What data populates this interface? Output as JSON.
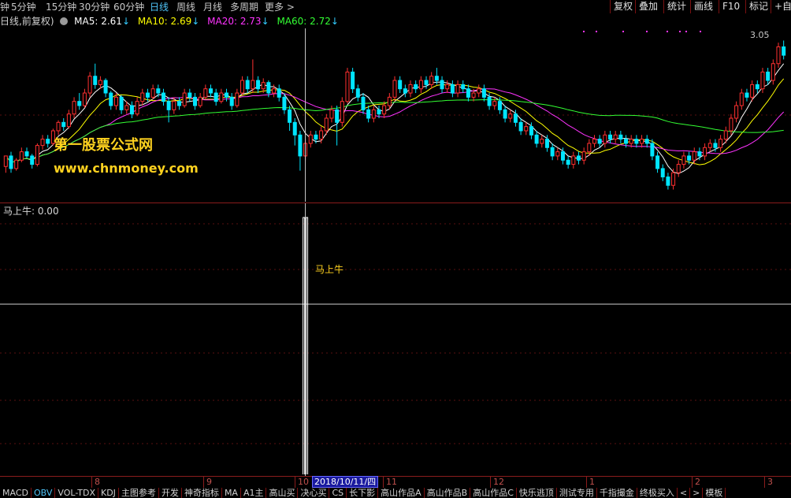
{
  "periods": [
    "钟",
    "5分钟",
    "15分钟",
    "30分钟",
    "60分钟",
    "日线",
    "周线",
    "月线",
    "多周期",
    "更多"
  ],
  "period_more_arrow": ">",
  "active_period": 5,
  "toolbar_right": [
    "复权",
    "叠加",
    "统计",
    "画线",
    "F10",
    "标记",
    "+自"
  ],
  "info": {
    "prefix": "日线,前复权)",
    "ma5": "MA5: 2.61",
    "ma10": "MA10: 2.69",
    "ma20": "MA20: 2.73",
    "ma60": "MA60: 2.72",
    "down_arrow": "↓",
    "colors": {
      "ma5": "#ffffff",
      "ma10": "#ffff00",
      "ma20": "#ff33ff",
      "ma60": "#33ff33"
    }
  },
  "price_label": "3.05",
  "watermark": {
    "line1": "第一股票公式网",
    "line2": "www.chnmoney.com"
  },
  "indicator": {
    "title": "马上牛: 0.00",
    "signal_label": "马上牛"
  },
  "date_axis": {
    "ticks": [
      "8",
      "9",
      "10",
      "11",
      "12",
      "1",
      "2",
      "3"
    ],
    "cursor_date": "2018/10/11/四"
  },
  "bottom_tabs": [
    "MACD",
    "OBV",
    "VOL-TDX",
    "KDJ",
    "主图参考",
    "开发",
    "神奇指标",
    "MA",
    "A1主",
    "高山买",
    "决心买",
    "CS",
    "长下影",
    "高山作品A",
    "高山作品B",
    "高山作品C",
    "快乐逃顶",
    "测试专用",
    "千指撮金",
    "终极买入",
    "<",
    ">",
    "模板"
  ],
  "active_tab": 1,
  "chart_data": {
    "type": "candlestick",
    "series": [
      {
        "name": "MA5",
        "color": "#ffffff"
      },
      {
        "name": "MA10",
        "color": "#ffff00"
      },
      {
        "name": "MA20",
        "color": "#ff33ff"
      },
      {
        "name": "MA60",
        "color": "#33ff33"
      }
    ],
    "colors": {
      "up": "#ff3030",
      "down": "#00e5ff"
    },
    "candles": [
      [
        2.45,
        2.5,
        2.5,
        2.42
      ],
      [
        2.5,
        2.44,
        2.52,
        2.42
      ],
      [
        2.44,
        2.48,
        2.49,
        2.43
      ],
      [
        2.48,
        2.52,
        2.54,
        2.47
      ],
      [
        2.52,
        2.5,
        2.54,
        2.49
      ],
      [
        2.5,
        2.46,
        2.51,
        2.44
      ],
      [
        2.46,
        2.55,
        2.56,
        2.45
      ],
      [
        2.55,
        2.58,
        2.6,
        2.53
      ],
      [
        2.58,
        2.56,
        2.6,
        2.54
      ],
      [
        2.56,
        2.62,
        2.63,
        2.55
      ],
      [
        2.62,
        2.66,
        2.67,
        2.6
      ],
      [
        2.66,
        2.64,
        2.68,
        2.62
      ],
      [
        2.64,
        2.7,
        2.72,
        2.63
      ],
      [
        2.7,
        2.76,
        2.78,
        2.68
      ],
      [
        2.76,
        2.74,
        2.8,
        2.72
      ],
      [
        2.74,
        2.8,
        2.82,
        2.73
      ],
      [
        2.8,
        2.88,
        2.9,
        2.78
      ],
      [
        2.88,
        2.84,
        2.94,
        2.82
      ],
      [
        2.84,
        2.86,
        2.88,
        2.82
      ],
      [
        2.86,
        2.8,
        2.87,
        2.78
      ],
      [
        2.8,
        2.74,
        2.81,
        2.72
      ],
      [
        2.74,
        2.78,
        2.8,
        2.72
      ],
      [
        2.78,
        2.72,
        2.79,
        2.7
      ],
      [
        2.72,
        2.74,
        2.76,
        2.7
      ],
      [
        2.74,
        2.7,
        2.76,
        2.68
      ],
      [
        2.7,
        2.76,
        2.78,
        2.69
      ],
      [
        2.76,
        2.8,
        2.82,
        2.74
      ],
      [
        2.8,
        2.78,
        2.82,
        2.76
      ],
      [
        2.78,
        2.82,
        2.84,
        2.77
      ],
      [
        2.82,
        2.8,
        2.84,
        2.78
      ],
      [
        2.8,
        2.76,
        2.82,
        2.74
      ],
      [
        2.76,
        2.72,
        2.78,
        2.66
      ],
      [
        2.72,
        2.76,
        2.78,
        2.7
      ],
      [
        2.76,
        2.74,
        2.78,
        2.72
      ],
      [
        2.74,
        2.8,
        2.82,
        2.73
      ],
      [
        2.8,
        2.78,
        2.82,
        2.76
      ],
      [
        2.78,
        2.74,
        2.8,
        2.72
      ],
      [
        2.74,
        2.78,
        2.8,
        2.73
      ],
      [
        2.78,
        2.82,
        2.84,
        2.77
      ],
      [
        2.82,
        2.8,
        2.84,
        2.78
      ],
      [
        2.8,
        2.76,
        2.82,
        2.74
      ],
      [
        2.76,
        2.8,
        2.82,
        2.75
      ],
      [
        2.8,
        2.78,
        2.82,
        2.76
      ],
      [
        2.78,
        2.74,
        2.8,
        2.72
      ],
      [
        2.74,
        2.8,
        2.82,
        2.73
      ],
      [
        2.8,
        2.86,
        2.88,
        2.79
      ],
      [
        2.86,
        2.82,
        2.88,
        2.8
      ],
      [
        2.82,
        2.86,
        2.96,
        2.8
      ],
      [
        2.86,
        2.82,
        2.88,
        2.8
      ],
      [
        2.82,
        2.85,
        2.87,
        2.8
      ],
      [
        2.85,
        2.8,
        2.86,
        2.78
      ],
      [
        2.8,
        2.82,
        2.84,
        2.78
      ],
      [
        2.82,
        2.78,
        2.84,
        2.76
      ],
      [
        2.78,
        2.72,
        2.8,
        2.7
      ],
      [
        2.72,
        2.66,
        2.74,
        2.62
      ],
      [
        2.66,
        2.6,
        2.68,
        2.55
      ],
      [
        2.6,
        2.5,
        2.62,
        2.43
      ],
      [
        2.5,
        2.56,
        2.58,
        2.48
      ],
      [
        2.56,
        2.6,
        2.62,
        2.54
      ],
      [
        2.6,
        2.58,
        2.62,
        2.56
      ],
      [
        2.58,
        2.62,
        2.64,
        2.56
      ],
      [
        2.62,
        2.68,
        2.7,
        2.6
      ],
      [
        2.68,
        2.72,
        2.74,
        2.66
      ],
      [
        2.72,
        2.66,
        2.74,
        2.55
      ],
      [
        2.66,
        2.76,
        2.78,
        2.64
      ],
      [
        2.76,
        2.9,
        2.92,
        2.75
      ],
      [
        2.9,
        2.82,
        2.92,
        2.8
      ],
      [
        2.82,
        2.78,
        2.84,
        2.76
      ],
      [
        2.78,
        2.72,
        2.8,
        2.7
      ],
      [
        2.72,
        2.68,
        2.74,
        2.66
      ],
      [
        2.68,
        2.72,
        2.74,
        2.66
      ],
      [
        2.72,
        2.7,
        2.74,
        2.68
      ],
      [
        2.7,
        2.74,
        2.76,
        2.68
      ],
      [
        2.74,
        2.78,
        2.8,
        2.72
      ],
      [
        2.78,
        2.86,
        2.88,
        2.76
      ],
      [
        2.86,
        2.82,
        2.88,
        2.8
      ],
      [
        2.82,
        2.8,
        2.84,
        2.78
      ],
      [
        2.8,
        2.84,
        2.86,
        2.78
      ],
      [
        2.84,
        2.82,
        2.86,
        2.8
      ],
      [
        2.82,
        2.86,
        2.88,
        2.8
      ],
      [
        2.86,
        2.84,
        2.88,
        2.82
      ],
      [
        2.84,
        2.88,
        2.9,
        2.82
      ],
      [
        2.88,
        2.86,
        2.92,
        2.84
      ],
      [
        2.86,
        2.82,
        2.88,
        2.8
      ],
      [
        2.82,
        2.84,
        2.86,
        2.8
      ],
      [
        2.84,
        2.8,
        2.86,
        2.78
      ],
      [
        2.8,
        2.84,
        2.86,
        2.78
      ],
      [
        2.84,
        2.82,
        2.86,
        2.8
      ],
      [
        2.82,
        2.78,
        2.84,
        2.76
      ],
      [
        2.78,
        2.8,
        2.82,
        2.76
      ],
      [
        2.8,
        2.82,
        2.84,
        2.78
      ],
      [
        2.82,
        2.78,
        2.84,
        2.76
      ],
      [
        2.78,
        2.74,
        2.8,
        2.72
      ],
      [
        2.74,
        2.76,
        2.78,
        2.72
      ],
      [
        2.76,
        2.72,
        2.78,
        2.7
      ],
      [
        2.72,
        2.68,
        2.74,
        2.66
      ],
      [
        2.68,
        2.7,
        2.72,
        2.66
      ],
      [
        2.7,
        2.66,
        2.72,
        2.64
      ],
      [
        2.66,
        2.62,
        2.68,
        2.6
      ],
      [
        2.62,
        2.64,
        2.66,
        2.6
      ],
      [
        2.64,
        2.6,
        2.66,
        2.58
      ],
      [
        2.6,
        2.56,
        2.62,
        2.54
      ],
      [
        2.56,
        2.58,
        2.6,
        2.54
      ],
      [
        2.58,
        2.54,
        2.6,
        2.52
      ],
      [
        2.54,
        2.5,
        2.56,
        2.48
      ],
      [
        2.5,
        2.52,
        2.54,
        2.48
      ],
      [
        2.52,
        2.48,
        2.54,
        2.46
      ],
      [
        2.48,
        2.46,
        2.5,
        2.44
      ],
      [
        2.46,
        2.5,
        2.52,
        2.44
      ],
      [
        2.5,
        2.48,
        2.52,
        2.46
      ],
      [
        2.48,
        2.52,
        2.54,
        2.46
      ],
      [
        2.52,
        2.56,
        2.58,
        2.5
      ],
      [
        2.56,
        2.58,
        2.6,
        2.54
      ],
      [
        2.58,
        2.56,
        2.6,
        2.54
      ],
      [
        2.56,
        2.6,
        2.62,
        2.54
      ],
      [
        2.6,
        2.58,
        2.62,
        2.56
      ],
      [
        2.58,
        2.6,
        2.62,
        2.56
      ],
      [
        2.6,
        2.58,
        2.62,
        2.56
      ],
      [
        2.58,
        2.56,
        2.6,
        2.54
      ],
      [
        2.56,
        2.58,
        2.6,
        2.54
      ],
      [
        2.58,
        2.56,
        2.6,
        2.54
      ],
      [
        2.56,
        2.58,
        2.6,
        2.54
      ],
      [
        2.58,
        2.56,
        2.6,
        2.54
      ],
      [
        2.56,
        2.5,
        2.58,
        2.48
      ],
      [
        2.5,
        2.44,
        2.52,
        2.42
      ],
      [
        2.44,
        2.4,
        2.46,
        2.38
      ],
      [
        2.4,
        2.36,
        2.42,
        2.34
      ],
      [
        2.36,
        2.42,
        2.44,
        2.34
      ],
      [
        2.42,
        2.46,
        2.48,
        2.4
      ],
      [
        2.46,
        2.5,
        2.52,
        2.44
      ],
      [
        2.5,
        2.48,
        2.52,
        2.46
      ],
      [
        2.48,
        2.52,
        2.54,
        2.46
      ],
      [
        2.52,
        2.5,
        2.54,
        2.48
      ],
      [
        2.5,
        2.54,
        2.56,
        2.48
      ],
      [
        2.54,
        2.56,
        2.58,
        2.52
      ],
      [
        2.56,
        2.54,
        2.58,
        2.52
      ],
      [
        2.54,
        2.58,
        2.6,
        2.52
      ],
      [
        2.58,
        2.62,
        2.64,
        2.56
      ],
      [
        2.62,
        2.68,
        2.7,
        2.6
      ],
      [
        2.68,
        2.74,
        2.76,
        2.66
      ],
      [
        2.74,
        2.8,
        2.82,
        2.72
      ],
      [
        2.8,
        2.78,
        2.82,
        2.76
      ],
      [
        2.78,
        2.84,
        2.86,
        2.76
      ],
      [
        2.84,
        2.82,
        2.86,
        2.8
      ],
      [
        2.82,
        2.9,
        2.92,
        2.8
      ],
      [
        2.9,
        2.86,
        2.92,
        2.84
      ],
      [
        2.86,
        2.94,
        2.96,
        2.84
      ],
      [
        2.94,
        3.02,
        3.04,
        2.92
      ],
      [
        3.02,
        2.98,
        3.05,
        2.96
      ]
    ],
    "indicator_signal": {
      "index": 57,
      "value": 1,
      "baseline": 0
    }
  }
}
